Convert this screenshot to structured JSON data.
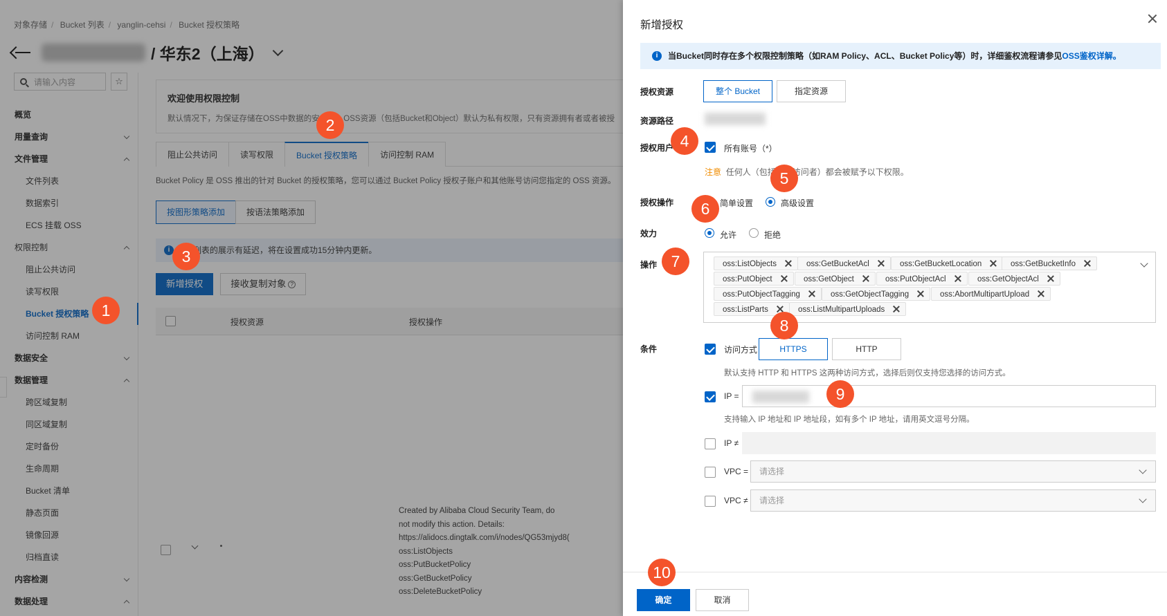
{
  "breadcrumb": [
    "对象存储",
    "Bucket 列表",
    "yanglin-cehsi",
    "Bucket 授权策略"
  ],
  "header": {
    "title": "/ 华东2（上海）"
  },
  "sidebar": {
    "search_placeholder": "请输入内容",
    "star": "☆",
    "items": [
      {
        "label": "概览",
        "kind": "group",
        "caret": ""
      },
      {
        "label": "用量查询",
        "kind": "group",
        "caret": "down"
      },
      {
        "label": "文件管理",
        "kind": "group",
        "caret": "up"
      },
      {
        "label": "文件列表",
        "kind": "sub",
        "caret": ""
      },
      {
        "label": "数据索引",
        "kind": "sub",
        "caret": ""
      },
      {
        "label": "ECS 挂载 OSS",
        "kind": "sub",
        "caret": ""
      },
      {
        "label": "权限控制",
        "kind": "group-plain",
        "caret": "up"
      },
      {
        "label": "阻止公共访问",
        "kind": "sub",
        "caret": ""
      },
      {
        "label": "读写权限",
        "kind": "sub",
        "caret": ""
      },
      {
        "label": "Bucket 授权策略",
        "kind": "sub-active",
        "caret": ""
      },
      {
        "label": "访问控制 RAM",
        "kind": "sub",
        "caret": ""
      },
      {
        "label": "数据安全",
        "kind": "group",
        "caret": "down"
      },
      {
        "label": "数据管理",
        "kind": "group",
        "caret": "up"
      },
      {
        "label": "跨区域复制",
        "kind": "sub",
        "caret": ""
      },
      {
        "label": "同区域复制",
        "kind": "sub",
        "caret": ""
      },
      {
        "label": "定时备份",
        "kind": "sub",
        "caret": ""
      },
      {
        "label": "生命周期",
        "kind": "sub",
        "caret": ""
      },
      {
        "label": "Bucket 清单",
        "kind": "sub",
        "caret": ""
      },
      {
        "label": "静态页面",
        "kind": "sub",
        "caret": ""
      },
      {
        "label": "镜像回源",
        "kind": "sub",
        "caret": ""
      },
      {
        "label": "归档直读",
        "kind": "sub",
        "caret": ""
      },
      {
        "label": "内容检测",
        "kind": "group",
        "caret": "down"
      },
      {
        "label": "数据处理",
        "kind": "group",
        "caret": "up"
      }
    ]
  },
  "main": {
    "welcome_title": "欢迎使用权限控制",
    "welcome_text": "默认情况下，为保证存储在OSS中数据的安全性，OSS资源（包括Bucket和Object）默认为私有权限，只有资源拥有者或者被授",
    "tabs": [
      "阻止公共访问",
      "读写权限",
      "Bucket 授权策略",
      "访问控制 RAM"
    ],
    "policy_desc": "Bucket Policy 是 OSS 推出的针对 Bucket 的授权策略，您可以通过 Bucket Policy 授权子账户和其他账号访问您指定的 OSS 资源。",
    "mode_buttons": [
      "按图形策略添加",
      "按语法策略添加"
    ],
    "notice": "授权列表的展示有延迟，将在设置成功15分钟内更新。",
    "add_button": "新增授权",
    "receive_button": "接收复制对象",
    "table_headers": [
      "授权资源",
      "授权操作"
    ],
    "row_action_text": [
      "Created by Alibaba Cloud Security Team, do",
      "not modify this action. Details:",
      "https://alidocs.dingtalk.com/i/nodes/QG53mjyd8(",
      "oss:ListObjects",
      "oss:PutBucketPolicy",
      "oss:GetBucketPolicy",
      "oss:DeleteBucketPolicy"
    ]
  },
  "drawer": {
    "title": "新增授权",
    "info": "当Bucket同时存在多个权限控制策略（如RAM Policy、ACL、Bucket Policy等）时，详细鉴权流程请参见",
    "info_link": "OSS鉴权详解。",
    "resource_label": "授权资源",
    "resource_options": [
      "整个 Bucket",
      "指定资源"
    ],
    "path_label": "资源路径",
    "user_label": "授权用户",
    "all_accounts": "所有账号（*）",
    "warn_word": "注意",
    "warn_text": "任何人（包括匿名访问者）都会被赋予以下权限。",
    "op_mode_label": "授权操作",
    "op_modes": [
      "简单设置",
      "高级设置"
    ],
    "effect_label": "效力",
    "effects": [
      "允许",
      "拒绝"
    ],
    "ops_label": "操作",
    "operations": [
      "oss:ListObjects",
      "oss:GetBucketAcl",
      "oss:GetBucketLocation",
      "oss:GetBucketInfo",
      "oss:PutObject",
      "oss:GetObject",
      "oss:PutObjectAcl",
      "oss:GetObjectAcl",
      "oss:PutObjectTagging",
      "oss:GetObjectTagging",
      "oss:AbortMultipartUpload",
      "oss:ListParts",
      "oss:ListMultipartUploads"
    ],
    "cond_label": "条件",
    "access_label": "访问方式",
    "protocols": [
      "HTTPS",
      "HTTP"
    ],
    "access_hint": "默认支持 HTTP 和 HTTPS 这两种访问方式，选择后则仅支持您选择的访问方式。",
    "ip_eq": "IP =",
    "ip_hint": "支持输入 IP 地址和 IP 地址段，如有多个 IP 地址，请用英文逗号分隔。",
    "ip_ne": "IP ≠",
    "vpc_eq": "VPC =",
    "vpc_ne": "VPC ≠",
    "select_placeholder": "请选择",
    "ok": "确定",
    "cancel": "取消"
  },
  "markers": [
    "1",
    "2",
    "3",
    "4",
    "5",
    "6",
    "7",
    "8",
    "9",
    "10"
  ],
  "colors": {
    "accent": "#0064c8",
    "marker": "#f4532b",
    "warning": "#f08c00"
  }
}
